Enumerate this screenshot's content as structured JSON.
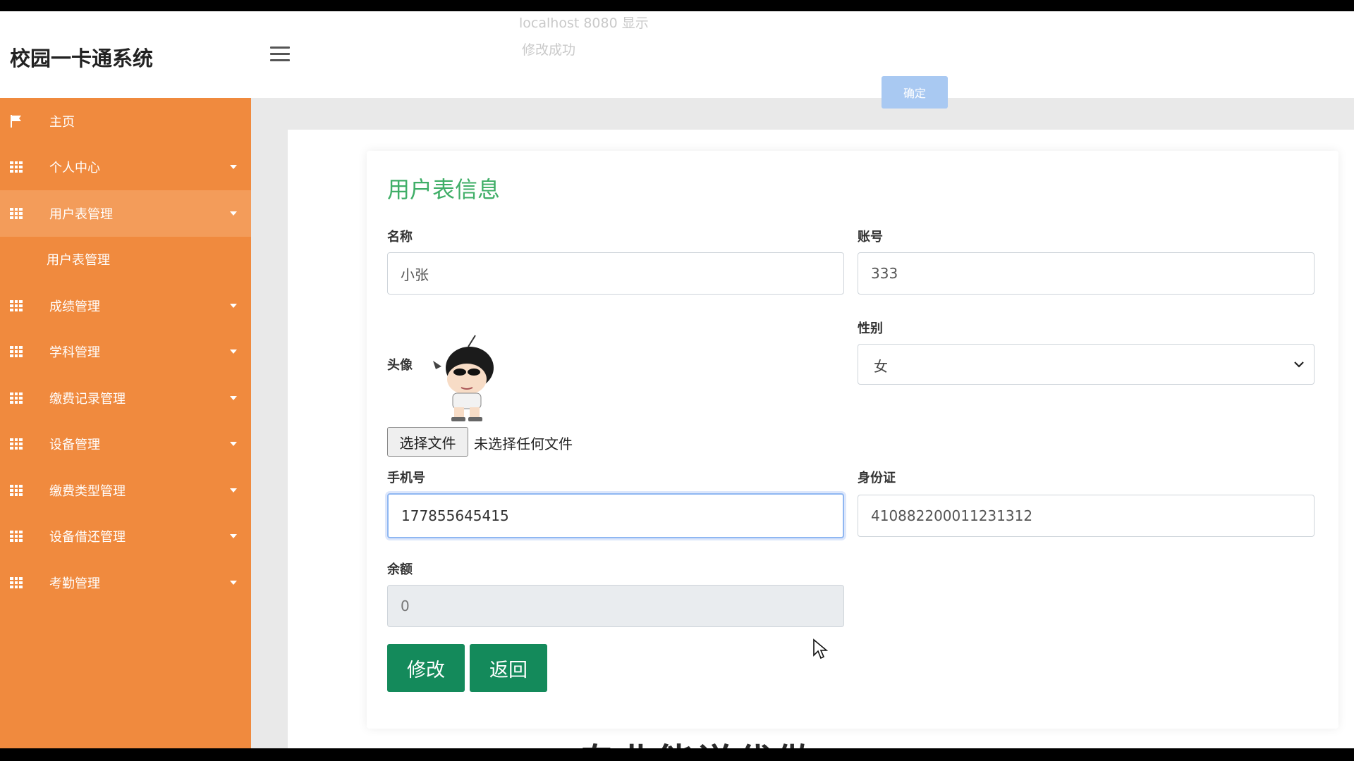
{
  "header": {
    "brand": "校园一卡通系统",
    "faint_line_1": "localhost 8080 显示",
    "faint_line_2": "修改成功",
    "top_button": "确定"
  },
  "sidebar": {
    "items": [
      {
        "label": "主页",
        "icon": "flag-icon"
      },
      {
        "label": "个人中心",
        "icon": "grid-icon"
      },
      {
        "label": "用户表管理",
        "icon": "grid-icon",
        "active": true
      },
      {
        "label": "用户表管理",
        "sub": true
      },
      {
        "label": "成绩管理",
        "icon": "grid-icon"
      },
      {
        "label": "学科管理",
        "icon": "grid-icon"
      },
      {
        "label": "缴费记录管理",
        "icon": "grid-icon"
      },
      {
        "label": "设备管理",
        "icon": "grid-icon"
      },
      {
        "label": "缴费类型管理",
        "icon": "grid-icon"
      },
      {
        "label": "设备借还管理",
        "icon": "grid-icon"
      },
      {
        "label": "考勤管理",
        "icon": "grid-icon"
      }
    ]
  },
  "form": {
    "title": "用户表信息",
    "name_label": "名称",
    "name_value": "小张",
    "account_label": "账号",
    "account_value": "333",
    "avatar_label": "头像",
    "gender_label": "性别",
    "gender_value": "女",
    "file_button": "选择文件",
    "file_status": "未选择任何文件",
    "phone_label": "手机号",
    "phone_value": "177855645415",
    "id_label": "身份证",
    "id_value": "410882200011231312",
    "balance_label": "余额",
    "balance_value": "0",
    "submit_button": "修改",
    "back_button": "返回"
  },
  "overlay": {
    "bottom_text": "专业能说代做"
  },
  "colors": {
    "sidebar": "#f08a3e",
    "accent_green": "#148a5b",
    "title_green": "#3fae67"
  }
}
